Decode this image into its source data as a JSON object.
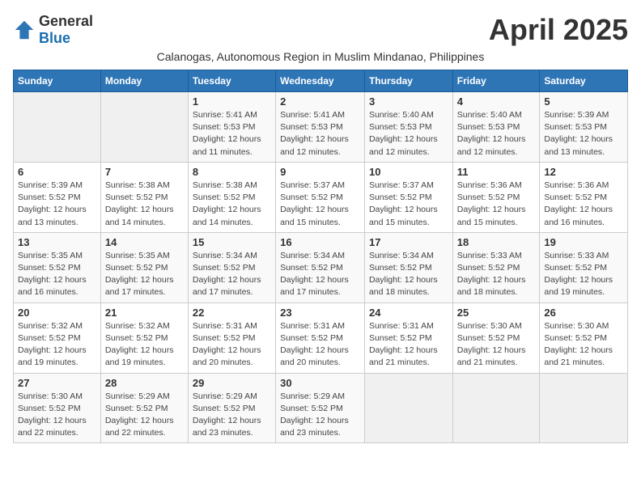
{
  "header": {
    "logo_general": "General",
    "logo_blue": "Blue",
    "month_title": "April 2025",
    "subtitle": "Calanogas, Autonomous Region in Muslim Mindanao, Philippines"
  },
  "days_of_week": [
    "Sunday",
    "Monday",
    "Tuesday",
    "Wednesday",
    "Thursday",
    "Friday",
    "Saturday"
  ],
  "weeks": [
    [
      {
        "day": "",
        "sunrise": "",
        "sunset": "",
        "daylight": ""
      },
      {
        "day": "",
        "sunrise": "",
        "sunset": "",
        "daylight": ""
      },
      {
        "day": "1",
        "sunrise": "Sunrise: 5:41 AM",
        "sunset": "Sunset: 5:53 PM",
        "daylight": "Daylight: 12 hours and 11 minutes."
      },
      {
        "day": "2",
        "sunrise": "Sunrise: 5:41 AM",
        "sunset": "Sunset: 5:53 PM",
        "daylight": "Daylight: 12 hours and 12 minutes."
      },
      {
        "day": "3",
        "sunrise": "Sunrise: 5:40 AM",
        "sunset": "Sunset: 5:53 PM",
        "daylight": "Daylight: 12 hours and 12 minutes."
      },
      {
        "day": "4",
        "sunrise": "Sunrise: 5:40 AM",
        "sunset": "Sunset: 5:53 PM",
        "daylight": "Daylight: 12 hours and 12 minutes."
      },
      {
        "day": "5",
        "sunrise": "Sunrise: 5:39 AM",
        "sunset": "Sunset: 5:53 PM",
        "daylight": "Daylight: 12 hours and 13 minutes."
      }
    ],
    [
      {
        "day": "6",
        "sunrise": "Sunrise: 5:39 AM",
        "sunset": "Sunset: 5:52 PM",
        "daylight": "Daylight: 12 hours and 13 minutes."
      },
      {
        "day": "7",
        "sunrise": "Sunrise: 5:38 AM",
        "sunset": "Sunset: 5:52 PM",
        "daylight": "Daylight: 12 hours and 14 minutes."
      },
      {
        "day": "8",
        "sunrise": "Sunrise: 5:38 AM",
        "sunset": "Sunset: 5:52 PM",
        "daylight": "Daylight: 12 hours and 14 minutes."
      },
      {
        "day": "9",
        "sunrise": "Sunrise: 5:37 AM",
        "sunset": "Sunset: 5:52 PM",
        "daylight": "Daylight: 12 hours and 15 minutes."
      },
      {
        "day": "10",
        "sunrise": "Sunrise: 5:37 AM",
        "sunset": "Sunset: 5:52 PM",
        "daylight": "Daylight: 12 hours and 15 minutes."
      },
      {
        "day": "11",
        "sunrise": "Sunrise: 5:36 AM",
        "sunset": "Sunset: 5:52 PM",
        "daylight": "Daylight: 12 hours and 15 minutes."
      },
      {
        "day": "12",
        "sunrise": "Sunrise: 5:36 AM",
        "sunset": "Sunset: 5:52 PM",
        "daylight": "Daylight: 12 hours and 16 minutes."
      }
    ],
    [
      {
        "day": "13",
        "sunrise": "Sunrise: 5:35 AM",
        "sunset": "Sunset: 5:52 PM",
        "daylight": "Daylight: 12 hours and 16 minutes."
      },
      {
        "day": "14",
        "sunrise": "Sunrise: 5:35 AM",
        "sunset": "Sunset: 5:52 PM",
        "daylight": "Daylight: 12 hours and 17 minutes."
      },
      {
        "day": "15",
        "sunrise": "Sunrise: 5:34 AM",
        "sunset": "Sunset: 5:52 PM",
        "daylight": "Daylight: 12 hours and 17 minutes."
      },
      {
        "day": "16",
        "sunrise": "Sunrise: 5:34 AM",
        "sunset": "Sunset: 5:52 PM",
        "daylight": "Daylight: 12 hours and 17 minutes."
      },
      {
        "day": "17",
        "sunrise": "Sunrise: 5:34 AM",
        "sunset": "Sunset: 5:52 PM",
        "daylight": "Daylight: 12 hours and 18 minutes."
      },
      {
        "day": "18",
        "sunrise": "Sunrise: 5:33 AM",
        "sunset": "Sunset: 5:52 PM",
        "daylight": "Daylight: 12 hours and 18 minutes."
      },
      {
        "day": "19",
        "sunrise": "Sunrise: 5:33 AM",
        "sunset": "Sunset: 5:52 PM",
        "daylight": "Daylight: 12 hours and 19 minutes."
      }
    ],
    [
      {
        "day": "20",
        "sunrise": "Sunrise: 5:32 AM",
        "sunset": "Sunset: 5:52 PM",
        "daylight": "Daylight: 12 hours and 19 minutes."
      },
      {
        "day": "21",
        "sunrise": "Sunrise: 5:32 AM",
        "sunset": "Sunset: 5:52 PM",
        "daylight": "Daylight: 12 hours and 19 minutes."
      },
      {
        "day": "22",
        "sunrise": "Sunrise: 5:31 AM",
        "sunset": "Sunset: 5:52 PM",
        "daylight": "Daylight: 12 hours and 20 minutes."
      },
      {
        "day": "23",
        "sunrise": "Sunrise: 5:31 AM",
        "sunset": "Sunset: 5:52 PM",
        "daylight": "Daylight: 12 hours and 20 minutes."
      },
      {
        "day": "24",
        "sunrise": "Sunrise: 5:31 AM",
        "sunset": "Sunset: 5:52 PM",
        "daylight": "Daylight: 12 hours and 21 minutes."
      },
      {
        "day": "25",
        "sunrise": "Sunrise: 5:30 AM",
        "sunset": "Sunset: 5:52 PM",
        "daylight": "Daylight: 12 hours and 21 minutes."
      },
      {
        "day": "26",
        "sunrise": "Sunrise: 5:30 AM",
        "sunset": "Sunset: 5:52 PM",
        "daylight": "Daylight: 12 hours and 21 minutes."
      }
    ],
    [
      {
        "day": "27",
        "sunrise": "Sunrise: 5:30 AM",
        "sunset": "Sunset: 5:52 PM",
        "daylight": "Daylight: 12 hours and 22 minutes."
      },
      {
        "day": "28",
        "sunrise": "Sunrise: 5:29 AM",
        "sunset": "Sunset: 5:52 PM",
        "daylight": "Daylight: 12 hours and 22 minutes."
      },
      {
        "day": "29",
        "sunrise": "Sunrise: 5:29 AM",
        "sunset": "Sunset: 5:52 PM",
        "daylight": "Daylight: 12 hours and 23 minutes."
      },
      {
        "day": "30",
        "sunrise": "Sunrise: 5:29 AM",
        "sunset": "Sunset: 5:52 PM",
        "daylight": "Daylight: 12 hours and 23 minutes."
      },
      {
        "day": "",
        "sunrise": "",
        "sunset": "",
        "daylight": ""
      },
      {
        "day": "",
        "sunrise": "",
        "sunset": "",
        "daylight": ""
      },
      {
        "day": "",
        "sunrise": "",
        "sunset": "",
        "daylight": ""
      }
    ]
  ]
}
